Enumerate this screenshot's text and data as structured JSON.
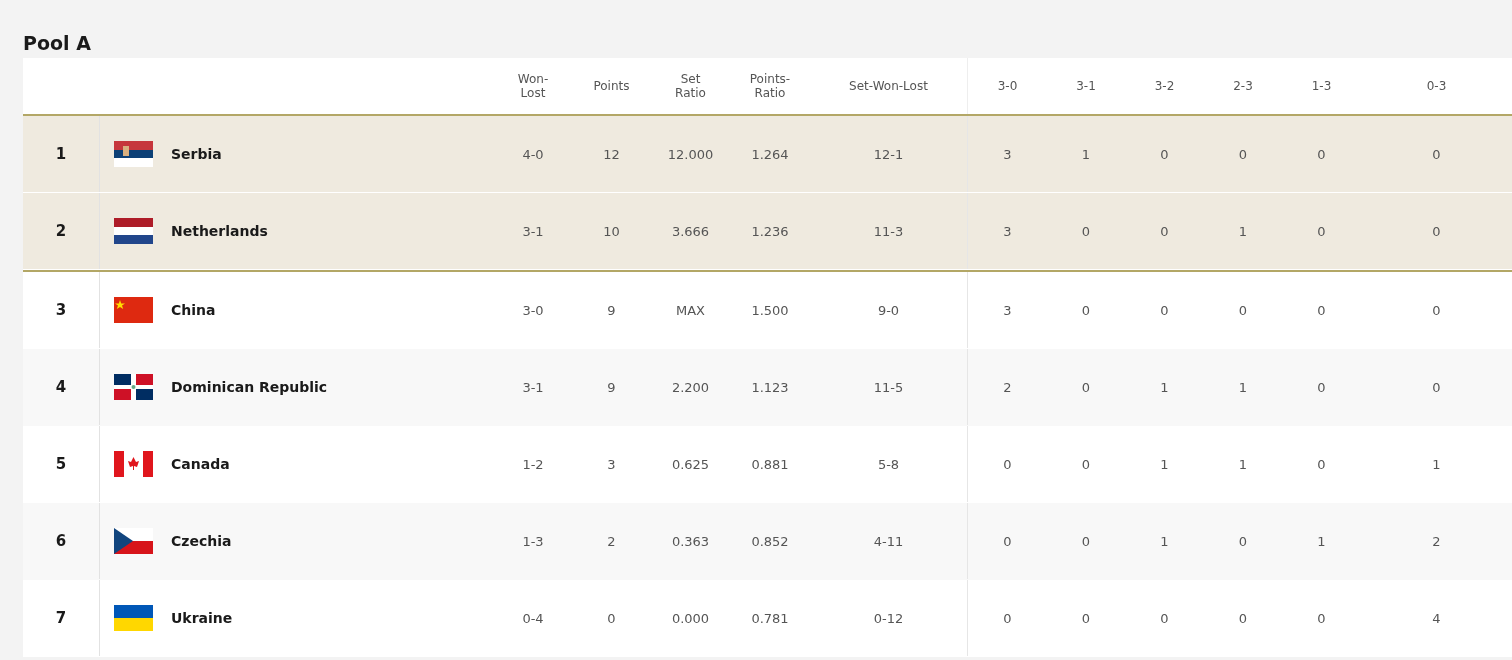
{
  "title": "Pool A",
  "columns": [
    {
      "label": "Won-\nLost"
    },
    {
      "label": "Points"
    },
    {
      "label": "Set\nRatio"
    },
    {
      "label": "Points-\nRatio"
    },
    {
      "label": "Set-Won-Lost"
    },
    {
      "label": "3-0"
    },
    {
      "label": "3-1"
    },
    {
      "label": "3-2"
    },
    {
      "label": "2-3"
    },
    {
      "label": "1-3"
    },
    {
      "label": "0-3"
    }
  ],
  "rows": [
    {
      "rank": "1",
      "team": "Serbia",
      "qualified": true,
      "cells": [
        "4-0",
        "12",
        "12.000",
        "1.264",
        "12-1",
        "3",
        "1",
        "0",
        "0",
        "0",
        "0"
      ]
    },
    {
      "rank": "2",
      "team": "Netherlands",
      "qualified": true,
      "cells": [
        "3-1",
        "10",
        "3.666",
        "1.236",
        "11-3",
        "3",
        "0",
        "0",
        "1",
        "0",
        "0"
      ]
    },
    {
      "rank": "3",
      "team": "China",
      "qualified": false,
      "cells": [
        "3-0",
        "9",
        "MAX",
        "1.500",
        "9-0",
        "3",
        "0",
        "0",
        "0",
        "0",
        "0"
      ]
    },
    {
      "rank": "4",
      "team": "Dominican Republic",
      "qualified": false,
      "cells": [
        "3-1",
        "9",
        "2.200",
        "1.123",
        "11-5",
        "2",
        "0",
        "1",
        "1",
        "0",
        "0"
      ]
    },
    {
      "rank": "5",
      "team": "Canada",
      "qualified": false,
      "cells": [
        "1-2",
        "3",
        "0.625",
        "0.881",
        "5-8",
        "0",
        "0",
        "1",
        "1",
        "0",
        "1"
      ]
    },
    {
      "rank": "6",
      "team": "Czechia",
      "qualified": false,
      "cells": [
        "1-3",
        "2",
        "0.363",
        "0.852",
        "4-11",
        "0",
        "0",
        "1",
        "0",
        "1",
        "2"
      ]
    },
    {
      "rank": "7",
      "team": "Ukraine",
      "qualified": false,
      "cells": [
        "0-4",
        "0",
        "0.000",
        "0.781",
        "0-12",
        "0",
        "0",
        "0",
        "0",
        "0",
        "4"
      ]
    }
  ]
}
